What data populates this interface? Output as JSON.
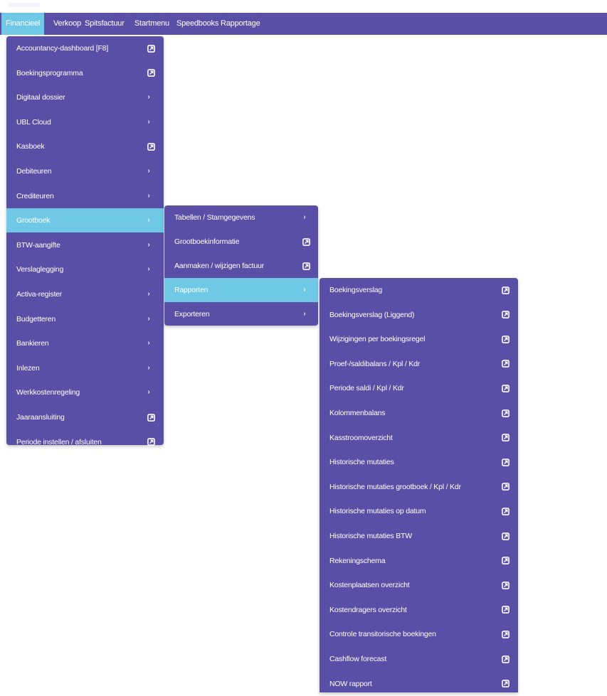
{
  "topbar": {
    "items": [
      "Financieel",
      "Verkoop",
      "Spitsfactuur",
      "Startmenu",
      "Speedbooks Rapportage"
    ]
  },
  "menu_financieel": {
    "items": [
      {
        "label": "Accountancy-dashboard [F8]",
        "icon": "external-link-icon"
      },
      {
        "label": "Boekingsprogramma",
        "icon": "external-link-icon"
      },
      {
        "label": "Digitaal dossier",
        "icon": "chevron-right-icon"
      },
      {
        "label": "UBL Cloud",
        "icon": "chevron-right-icon"
      },
      {
        "label": "Kasboek",
        "icon": "external-link-icon"
      },
      {
        "label": "Debiteuren",
        "icon": "chevron-right-icon"
      },
      {
        "label": "Crediteuren",
        "icon": "chevron-right-icon"
      },
      {
        "label": "Grootboek",
        "icon": "chevron-right-icon"
      },
      {
        "label": "BTW-aangifte",
        "icon": "chevron-right-icon"
      },
      {
        "label": "Verslaglegging",
        "icon": "chevron-right-icon"
      },
      {
        "label": "Activa-register",
        "icon": "chevron-right-icon"
      },
      {
        "label": "Budgetteren",
        "icon": "chevron-right-icon"
      },
      {
        "label": "Bankieren",
        "icon": "chevron-right-icon"
      },
      {
        "label": "Inlezen",
        "icon": "chevron-right-icon"
      },
      {
        "label": "Werkkostenregeling",
        "icon": "chevron-right-icon"
      },
      {
        "label": "Jaaraansluiting",
        "icon": "external-link-icon"
      },
      {
        "label": "Periode instellen / afsluiten",
        "icon": "external-link-icon"
      }
    ]
  },
  "menu_grootboek": {
    "items": [
      {
        "label": "Tabellen / Stamgegevens",
        "icon": "chevron-right-icon"
      },
      {
        "label": "Grootboekinformatie",
        "icon": "external-link-icon"
      },
      {
        "label": "Aanmaken / wijzigen factuur",
        "icon": "external-link-icon"
      },
      {
        "label": "Rapporten",
        "icon": "chevron-right-icon"
      },
      {
        "label": "Exporteren",
        "icon": "chevron-right-icon"
      }
    ]
  },
  "menu_rapporten": {
    "items": [
      {
        "label": "Boekingsverslag",
        "icon": "external-link-icon"
      },
      {
        "label": "Boekingsverslag (Liggend)",
        "icon": "external-link-icon"
      },
      {
        "label": "Wijzigingen per boekingsregel",
        "icon": "external-link-icon"
      },
      {
        "label": "Proef-/saldibalans / Kpl / Kdr",
        "icon": "external-link-icon"
      },
      {
        "label": "Periode saldi / Kpl / Kdr",
        "icon": "external-link-icon"
      },
      {
        "label": "Kolommenbalans",
        "icon": "external-link-icon"
      },
      {
        "label": "Kasstroomoverzicht",
        "icon": "external-link-icon"
      },
      {
        "label": "Historische mutaties",
        "icon": "external-link-icon"
      },
      {
        "label": "Historische mutaties grootboek / Kpl / Kdr",
        "icon": "external-link-icon"
      },
      {
        "label": "Historische mutaties op datum",
        "icon": "external-link-icon"
      },
      {
        "label": "Historische mutaties BTW",
        "icon": "external-link-icon"
      },
      {
        "label": "Rekeningschema",
        "icon": "external-link-icon"
      },
      {
        "label": "Kostenplaatsen overzicht",
        "icon": "external-link-icon"
      },
      {
        "label": "Kostendragers overzicht",
        "icon": "external-link-icon"
      },
      {
        "label": "Controle transitorische boekingen",
        "icon": "external-link-icon"
      },
      {
        "label": "Cashflow forecast",
        "icon": "external-link-icon"
      },
      {
        "label": "NOW rapport",
        "icon": "external-link-icon"
      }
    ]
  },
  "state": {
    "active_top": "Financieel",
    "active_path": [
      "Grootboek",
      "Rapporten"
    ]
  },
  "colors": {
    "menu_bg": "#5a4fa6",
    "highlight": "#6ec8e6",
    "text": "#ffffff"
  }
}
